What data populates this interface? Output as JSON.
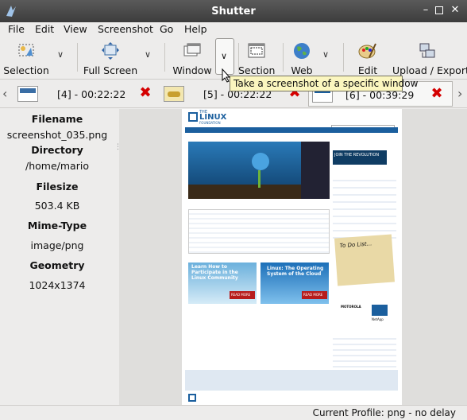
{
  "window": {
    "title": "Shutter"
  },
  "menu": [
    "File",
    "Edit",
    "View",
    "Screenshot",
    "Go",
    "Help"
  ],
  "toolbar": {
    "selection": "Selection",
    "full_screen": "Full Screen",
    "window": "Window",
    "section": "Section",
    "web": "Web",
    "edit": "Edit",
    "upload_export": "Upload / Export"
  },
  "tooltip": "Take a screenshot of a specific window",
  "tabs": [
    {
      "label": "[4] - 00:22:22"
    },
    {
      "label": "[5] - 00:22:22"
    },
    {
      "label": "[6] - 00:39:29"
    }
  ],
  "properties": {
    "filename_label": "Filename",
    "filename": "screenshot_035.png",
    "directory_label": "Directory",
    "directory": "/home/mario",
    "filesize_label": "Filesize",
    "filesize": "503.4 KB",
    "mimetype_label": "Mime-Type",
    "mimetype": "image/png",
    "geometry_label": "Geometry",
    "geometry": "1024x1374"
  },
  "preview": {
    "logo_the": "THE",
    "logo_linux": "LINUX",
    "logo_foundation": "FOUNDATION",
    "join": "JOIN THE REVOLUTION",
    "promo1": "Learn How to Participate in the Linux Community",
    "promo2": "Linux: The Operating System of the Cloud",
    "read_more": "READ MORE",
    "todo": "To Do List...",
    "motorola": "MOTOROLA",
    "netapp": "NetApp"
  },
  "status": "Current Profile: png - no delay",
  "colors": {
    "accent": "#1b5f9e",
    "close": "#d40000",
    "tooltip_bg": "#fbf6bf"
  }
}
